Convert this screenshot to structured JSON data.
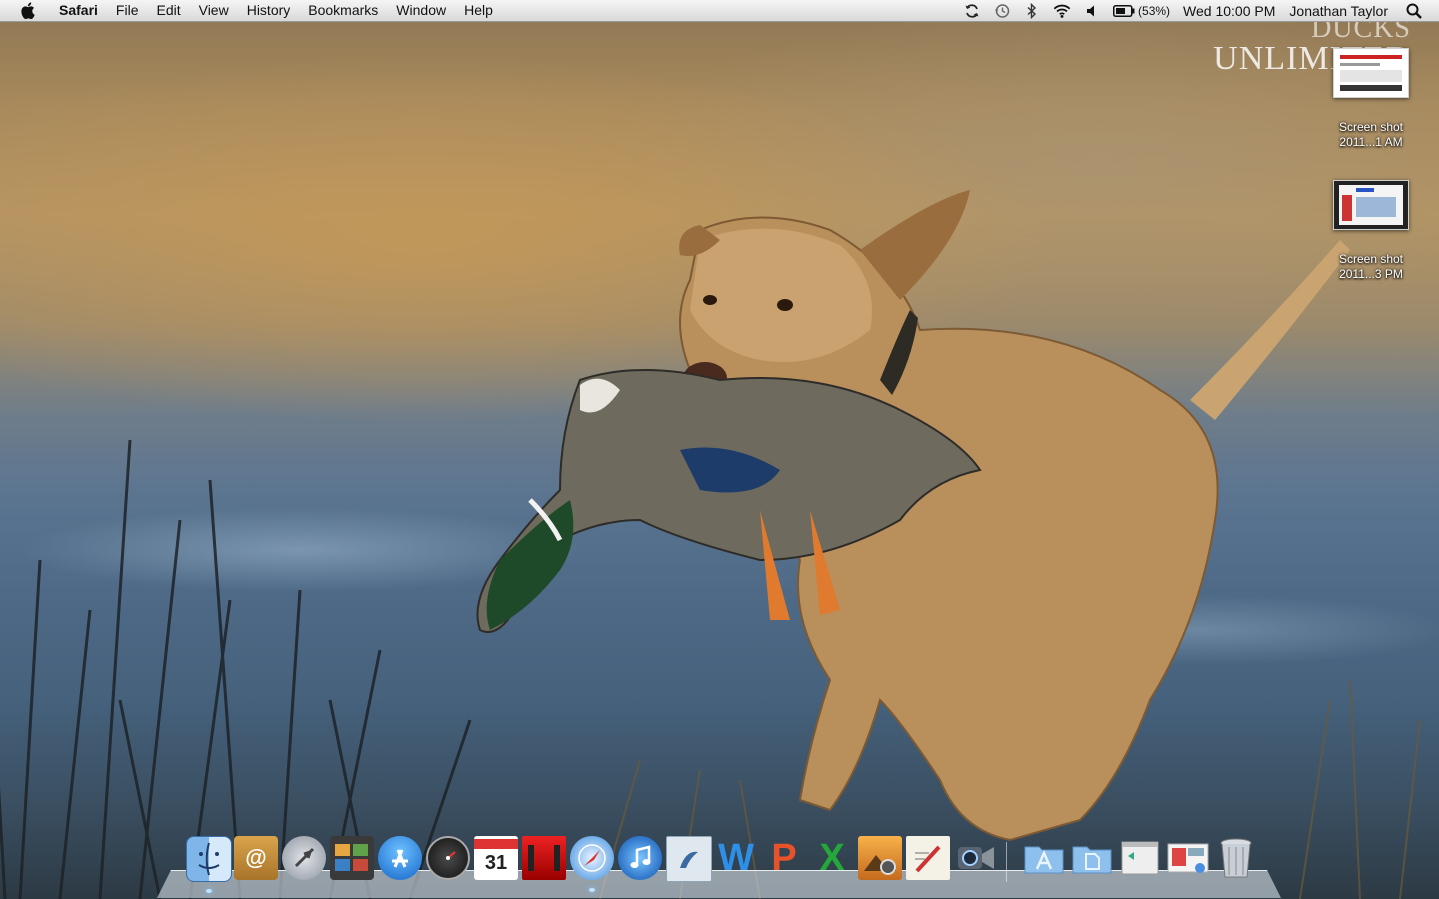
{
  "menubar": {
    "app_name": "Safari",
    "menus": [
      "File",
      "Edit",
      "View",
      "History",
      "Bookmarks",
      "Window",
      "Help"
    ],
    "battery_percent": "(53%)",
    "clock": "Wed 10:00 PM",
    "user": "Jonathan Taylor"
  },
  "wallpaper": {
    "watermark_line1": "DUCKS",
    "watermark_line2": "UNLIMITED"
  },
  "desktop_icons": [
    {
      "line1": "Screen shot",
      "line2": "2011...1 AM"
    },
    {
      "line1": "Screen shot",
      "line2": "2011...3 PM"
    }
  ],
  "dock": {
    "apps": [
      "finder",
      "address-book",
      "launchpad",
      "photo-booth",
      "app-store",
      "dashboard",
      "ical",
      "movie",
      "safari",
      "itunes",
      "preview",
      "word",
      "powerpoint",
      "excel",
      "iphoto",
      "textedit",
      "facetime"
    ],
    "stacks": [
      "applications",
      "documents",
      "window-minimized",
      "downloads",
      "trash"
    ],
    "ical_date": "31"
  }
}
